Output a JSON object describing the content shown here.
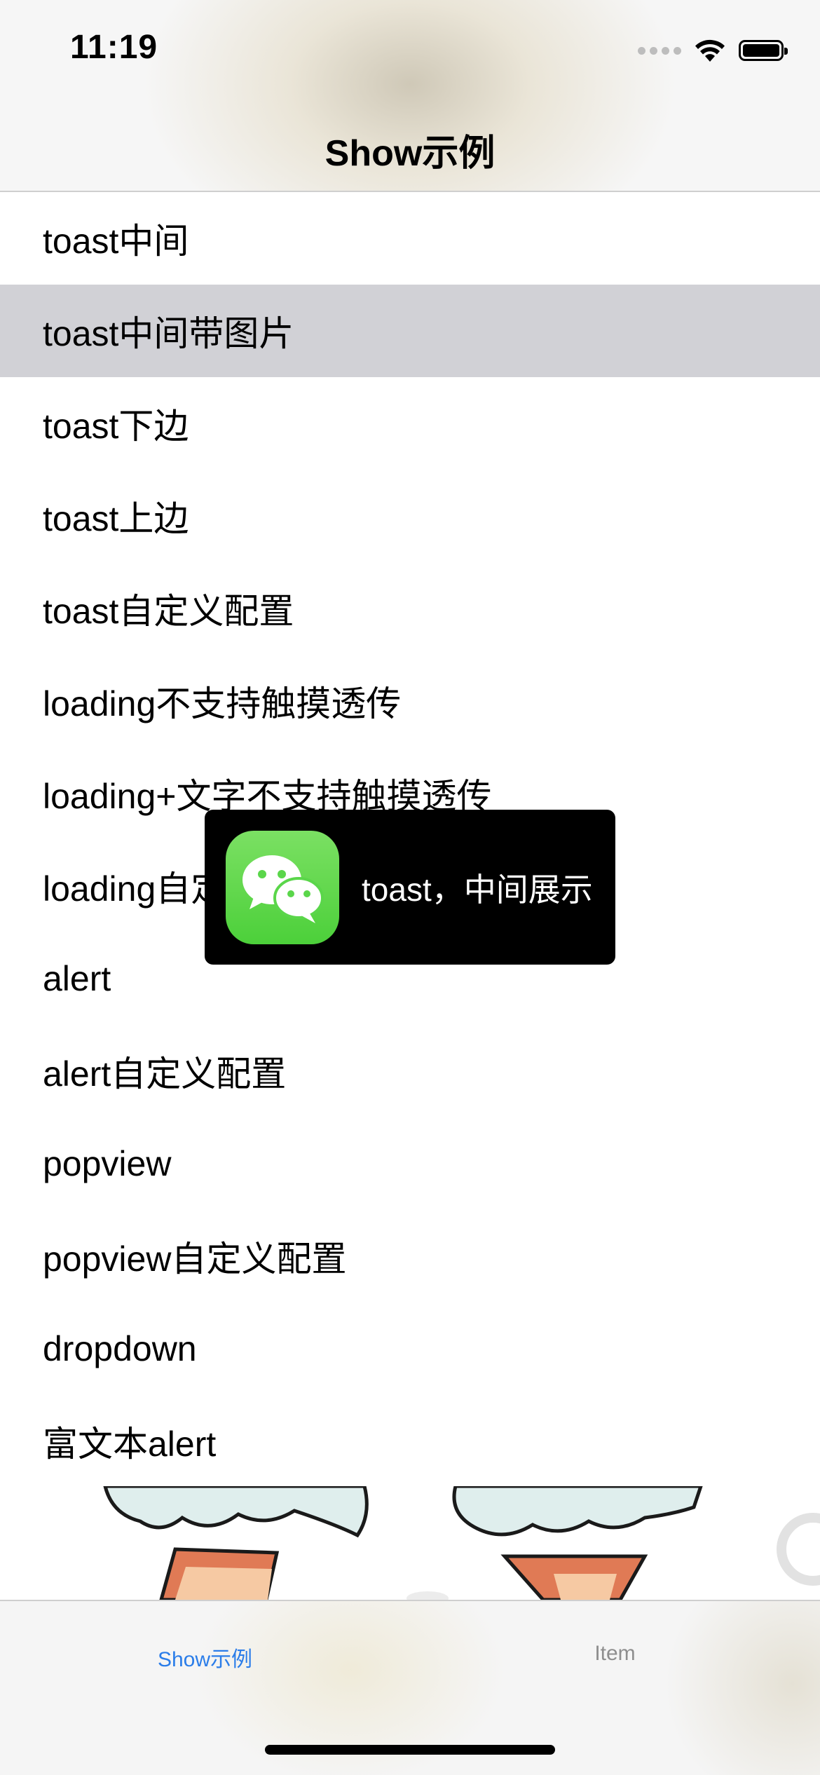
{
  "status_bar": {
    "time": "11:19"
  },
  "nav": {
    "title": "Show示例"
  },
  "list": {
    "items": [
      "toast中间",
      "toast中间带图片",
      "toast下边",
      "toast上边",
      "toast自定义配置",
      "loading不支持触摸透传",
      "loading+文字不支持触摸透传",
      "loading自定义配置",
      "alert",
      "alert自定义配置",
      "popview",
      "popview自定义配置",
      "dropdown",
      "富文本alert"
    ],
    "selected_index": 1
  },
  "toast": {
    "text": "toast，中间展示",
    "icon": "wechat-icon"
  },
  "tab_bar": {
    "tabs": [
      {
        "label": "Show示例",
        "active": true
      },
      {
        "label": "Item",
        "active": false
      }
    ]
  },
  "colors": {
    "accent": "#2b7de9",
    "selected_row": "#d1d1d6",
    "toast_background": "#000000",
    "wechat_green": "#5ad64a"
  }
}
